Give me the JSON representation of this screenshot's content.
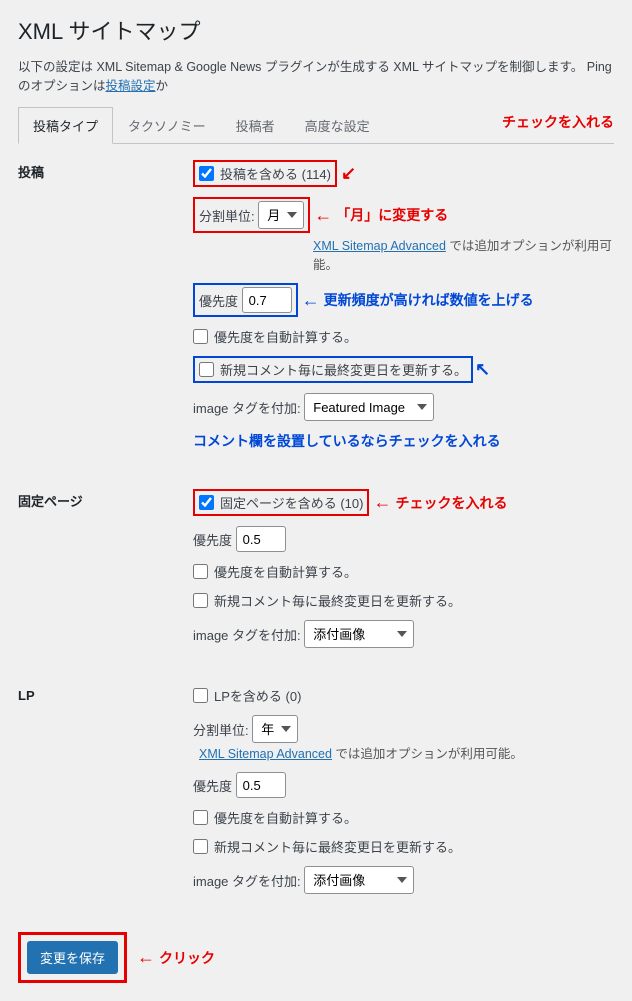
{
  "page": {
    "title": "XML サイトマップ",
    "description_pre": "以下の設定は XML Sitemap & Google News プラグインが生成する XML サイトマップを制御します。 Ping のオプションは",
    "description_link": "投稿設定",
    "description_post": "か"
  },
  "tabs": {
    "post_types": "投稿タイプ",
    "taxonomies": "タクソノミー",
    "authors": "投稿者",
    "advanced": "高度な設定"
  },
  "labels": {
    "split_by": "分割単位:",
    "priority": "優先度",
    "auto_priority": "優先度を自動計算する。",
    "update_on_comment": "新規コメント毎に最終変更日を更新する。",
    "image_tag": "image タグを付加:",
    "advanced_hint_link": "XML Sitemap Advanced",
    "advanced_hint_text": " では追加オプションが利用可能。"
  },
  "posts": {
    "section": "投稿",
    "include": "投稿を含める (114)",
    "split_value": "月",
    "priority_value": "0.7",
    "image_value": "Featured Image"
  },
  "pages": {
    "section": "固定ページ",
    "include": "固定ページを含める (10)",
    "priority_value": "0.5",
    "image_value": "添付画像"
  },
  "lp": {
    "section": "LP",
    "include": "LPを含める (0)",
    "split_value": "年",
    "priority_value": "0.5",
    "image_value": "添付画像"
  },
  "annotations": {
    "check_it": "チェックを入れる",
    "change_month": "「月」に変更する",
    "raise_priority": "更新頻度が高ければ数値を上げる",
    "comment_check": "コメント欄を設置しているならチェックを入れる",
    "click": "クリック"
  },
  "submit": {
    "save": "変更を保存"
  }
}
